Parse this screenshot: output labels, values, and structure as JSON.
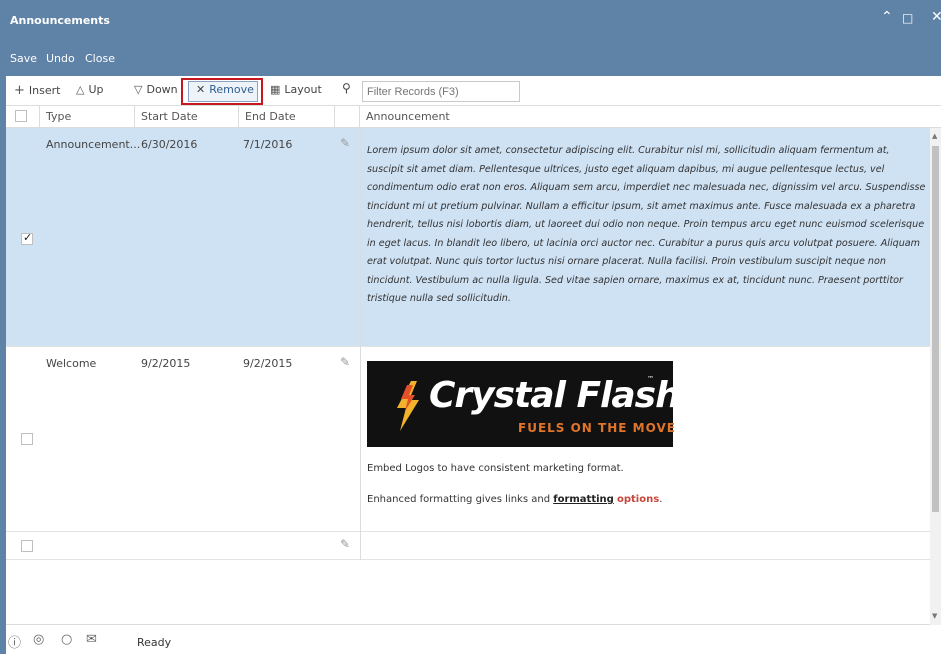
{
  "window": {
    "title": "Announcements",
    "controls": [
      "collapse-icon",
      "maximize-icon",
      "close-icon"
    ]
  },
  "menu": {
    "save": "Save",
    "undo": "Undo",
    "close": "Close"
  },
  "toolbar": {
    "insert": "Insert",
    "up": "Up",
    "down": "Down",
    "remove": "Remove",
    "layout": "Layout",
    "filter_placeholder": "Filter Records (F3)"
  },
  "columns": {
    "type": "Type",
    "start": "Start Date",
    "end": "End Date",
    "announcement": "Announcement"
  },
  "rows": [
    {
      "type": "Announcement...",
      "start": "6/30/2016",
      "end": "7/1/2016",
      "checked": true,
      "announcement": "Lorem ipsum dolor sit amet, consectetur adipiscing elit. Curabitur nisl mi, sollicitudin aliquam fermentum at, suscipit sit amet diam. Pellentesque ultrices, justo eget aliquam dapibus, mi augue pellentesque lectus, vel condimentum odio erat non eros. Aliquam sem arcu, imperdiet nec malesuada nec, dignissim vel arcu. Suspendisse tincidunt mi ut pretium pulvinar. Nullam a efficitur ipsum, sit amet maximus ante. Fusce malesuada ex a pharetra hendrerit, tellus nisi lobortis diam, ut laoreet dui odio non neque. Proin tempus arcu eget nunc euismod scelerisque in eget lacus. In blandit leo libero, ut lacinia orci auctor nec. Curabitur a purus quis arcu volutpat posuere. Aliquam erat volutpat. Nunc quis tortor luctus nisi ornare placerat. Nulla facilisi. Proin vestibulum suscipit neque non tincidunt. Vestibulum ac nulla ligula. Sed vitae sapien ornare, maximus ex at, tincidunt nunc. Praesent porttitor tristique nulla sed sollicitudin."
    },
    {
      "type": "Welcome",
      "start": "9/2/2015",
      "end": "9/2/2015",
      "checked": false,
      "logo": {
        "name": "Crystal Flash",
        "tm": "™",
        "tagline": "FUELS ON THE MOVE"
      },
      "embed_text": "Embed Logos to have consistent marketing format.",
      "enhanced_prefix": "Enhanced formatting gives links and ",
      "enhanced_link": "formatting",
      "enhanced_colored": "options",
      "enhanced_suffix": "."
    },
    {
      "type": "",
      "start": "",
      "end": "",
      "checked": false
    }
  ],
  "status": {
    "text": "Ready",
    "icons": [
      "help-icon",
      "support-icon",
      "lightbulb-icon",
      "mail-icon"
    ]
  },
  "colors": {
    "chrome": "#5f82a7",
    "selected_row": "#cfe2f4",
    "highlight": "#c6171e",
    "options_text": "#c9463a"
  }
}
